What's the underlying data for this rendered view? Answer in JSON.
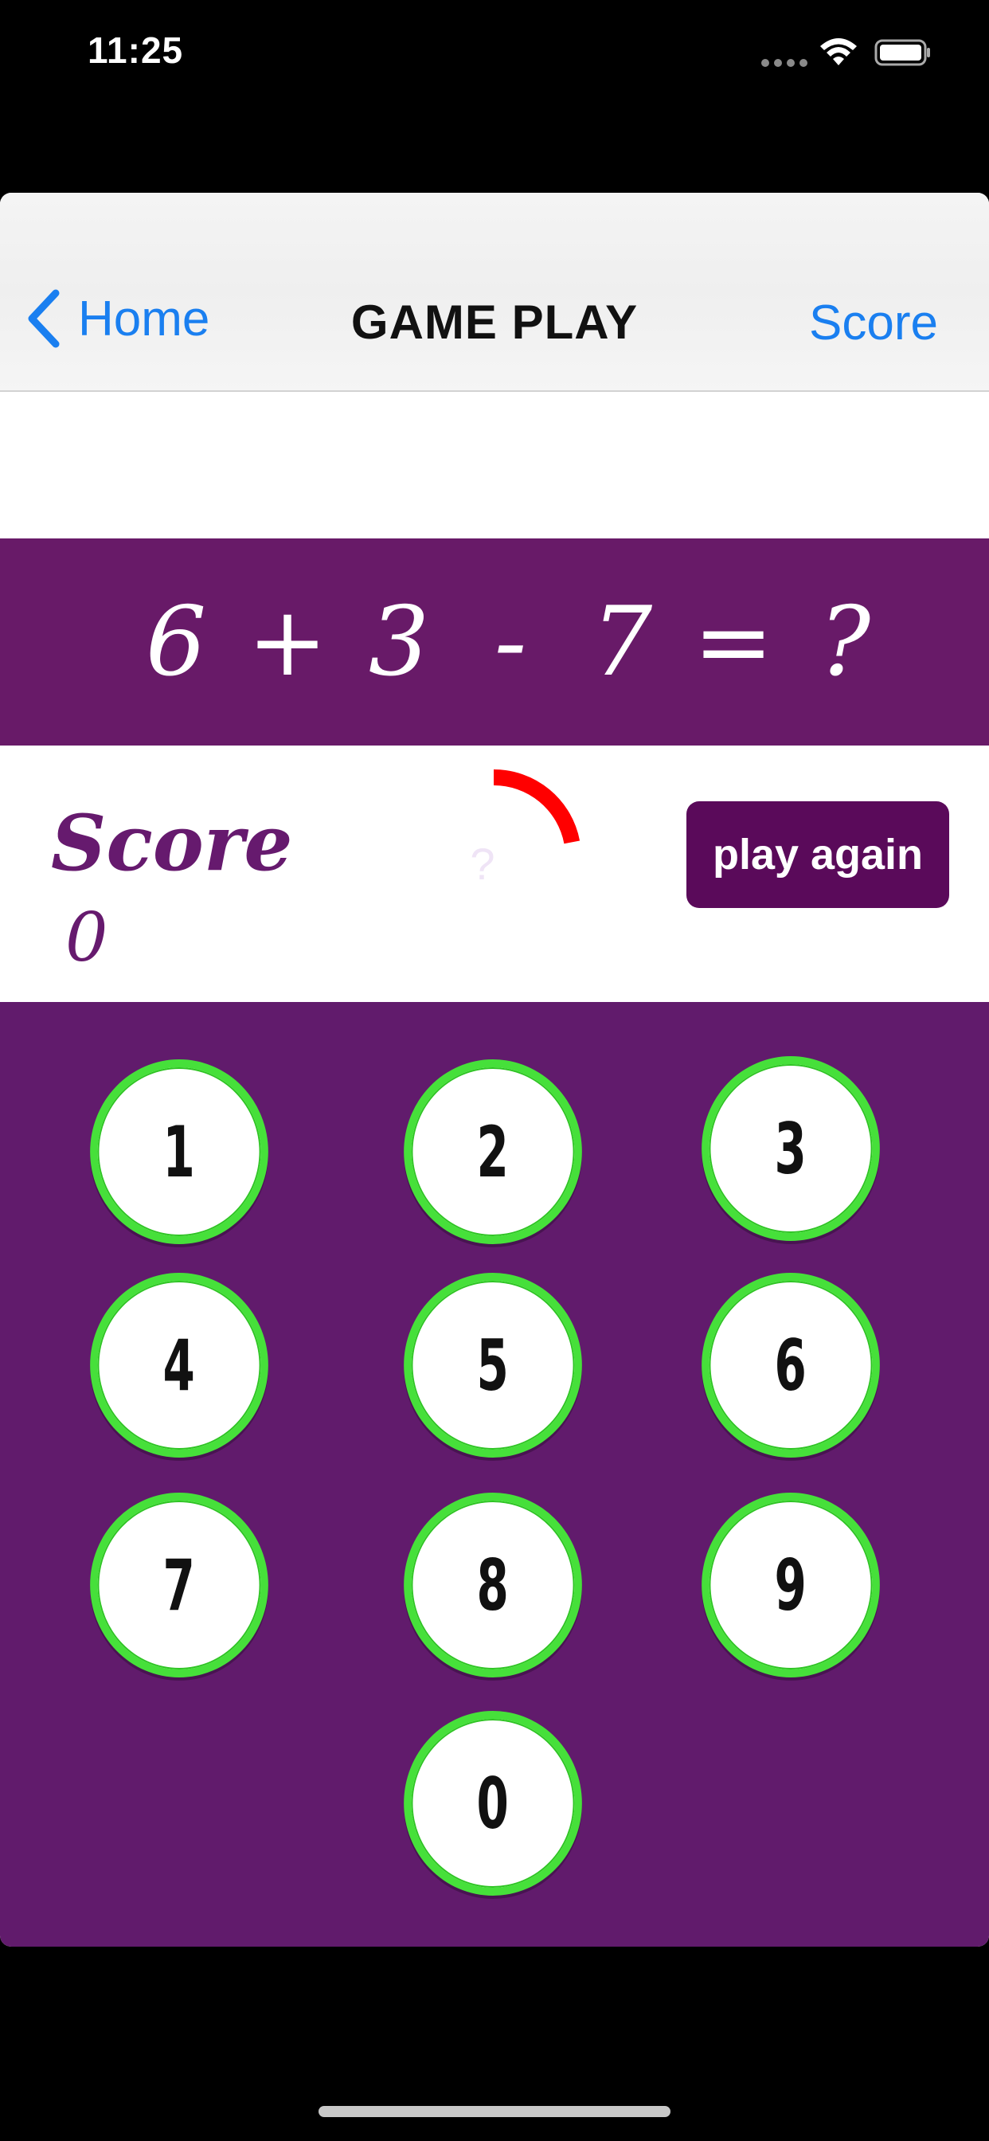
{
  "status_bar": {
    "time": "11:25"
  },
  "nav": {
    "back_label": "Home",
    "title": "GAME PLAY",
    "right_label": "Score"
  },
  "equation": {
    "parts": [
      "6",
      "+",
      "3",
      "-",
      "7",
      "=",
      "?"
    ]
  },
  "score": {
    "label": "Score",
    "value": "0"
  },
  "timer": {
    "text": "?",
    "progress_fraction": 0.22
  },
  "play_again_label": "play again",
  "keypad": {
    "keys": [
      "1",
      "2",
      "3",
      "4",
      "5",
      "6",
      "7",
      "8",
      "9",
      "0"
    ]
  },
  "colors": {
    "brand_purple": "#681a68",
    "keypad_background": "#611b6c",
    "key_border": "#46e03a",
    "timer_ring": "#ff0000",
    "link_blue": "#1a7ff0"
  }
}
